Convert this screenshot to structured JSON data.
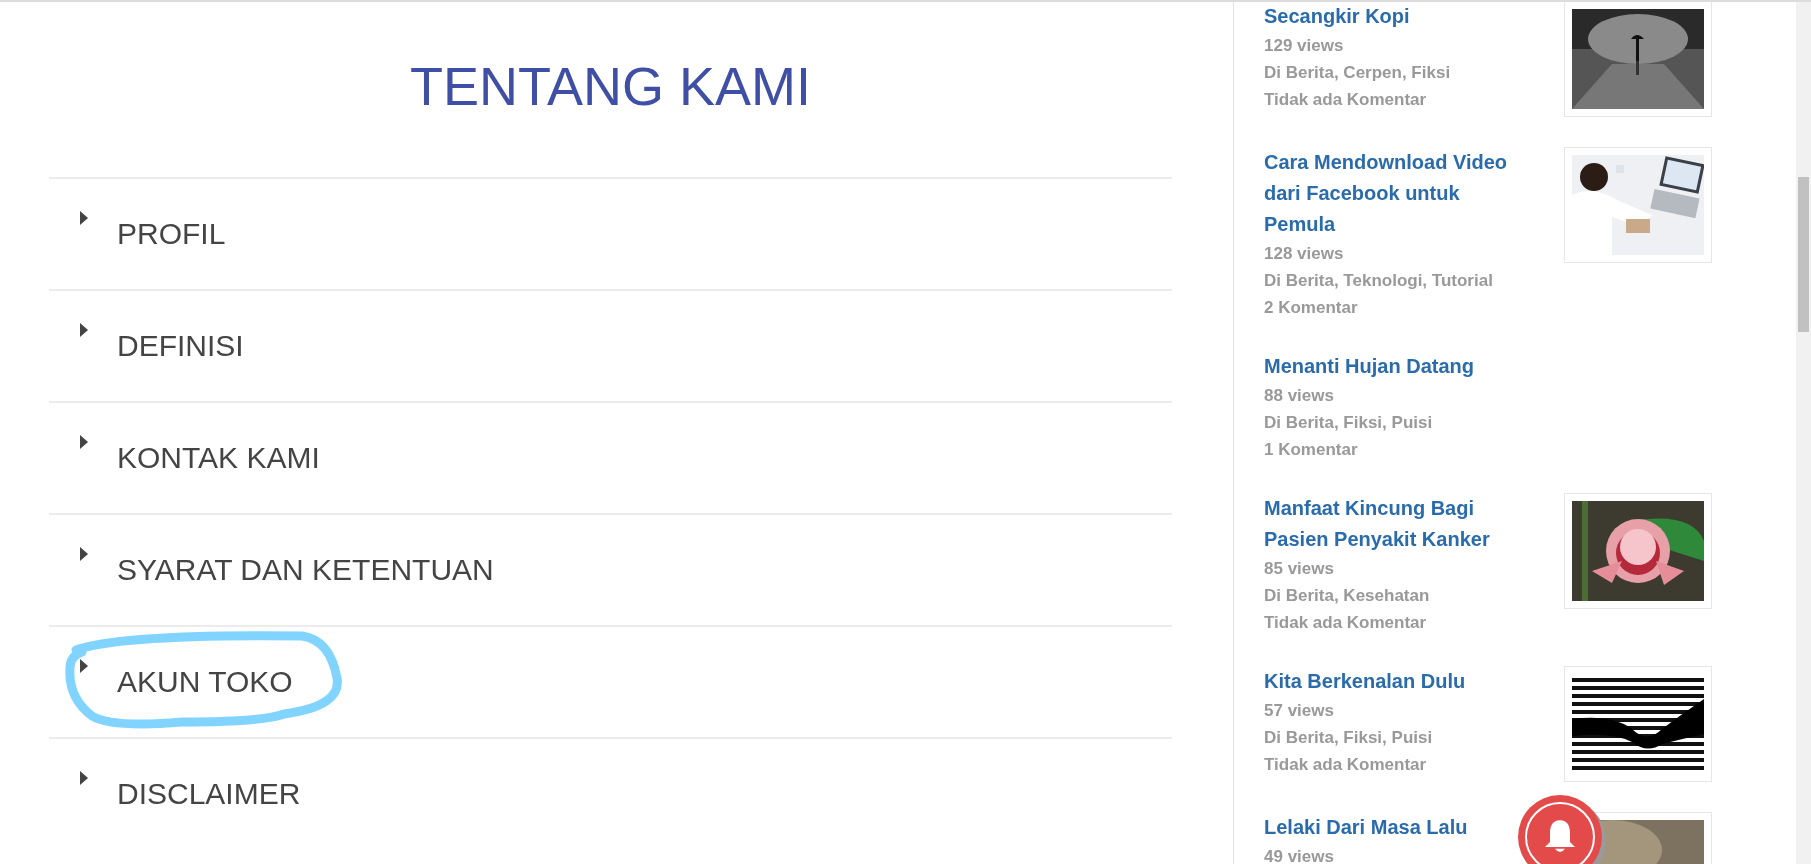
{
  "page_title": "TENTANG KAMI",
  "menu": [
    {
      "label": "PROFIL",
      "highlighted": false
    },
    {
      "label": "DEFINISI",
      "highlighted": false
    },
    {
      "label": "KONTAK KAMI",
      "highlighted": false
    },
    {
      "label": "SYARAT DAN KETENTUAN",
      "highlighted": false
    },
    {
      "label": "AKUN TOKO",
      "highlighted": true
    },
    {
      "label": "DISCLAIMER",
      "highlighted": false
    }
  ],
  "sidebar_posts": [
    {
      "title": "Secangkir Kopi",
      "views": "129 views",
      "categories": "Di Berita, Cerpen, Fiksi",
      "comments": "Tidak ada Komentar"
    },
    {
      "title": "Cara Mendownload Video dari Facebook untuk Pemula",
      "views": "128 views",
      "categories": "Di Berita, Teknologi, Tutorial",
      "comments": "2 Komentar"
    },
    {
      "title": "Menanti Hujan Datang",
      "views": "88 views",
      "categories": "Di Berita, Fiksi, Puisi",
      "comments": "1 Komentar"
    },
    {
      "title": "Manfaat Kincung Bagi Pasien Penyakit Kanker",
      "views": "85 views",
      "categories": "Di Berita, Kesehatan",
      "comments": "Tidak ada Komentar"
    },
    {
      "title": "Kita Berkenalan Dulu",
      "views": "57 views",
      "categories": "Di Berita, Fiksi, Puisi",
      "comments": "Tidak ada Komentar"
    },
    {
      "title": "Lelaki Dari Masa Lalu",
      "views": "49 views"
    }
  ]
}
